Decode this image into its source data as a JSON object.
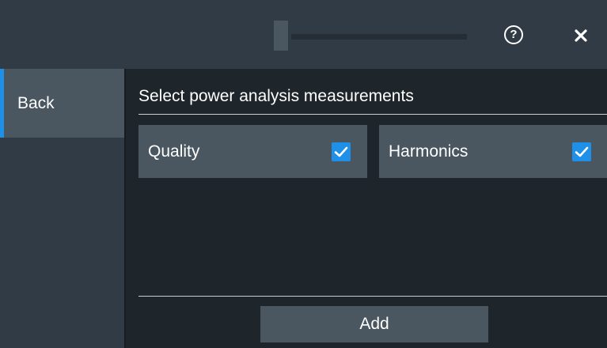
{
  "header": {
    "help_icon": "help-icon",
    "help_glyph": "?",
    "close_icon": "close-icon"
  },
  "sidebar": {
    "back_label": "Back"
  },
  "main": {
    "title": "Select power analysis measurements",
    "options": [
      {
        "label": "Quality",
        "checked": true
      },
      {
        "label": "Harmonics",
        "checked": true
      }
    ],
    "add_label": "Add"
  },
  "colors": {
    "accent": "#1e90e8",
    "panel": "#303b45",
    "button": "#4a5761",
    "background": "#1e252b"
  }
}
